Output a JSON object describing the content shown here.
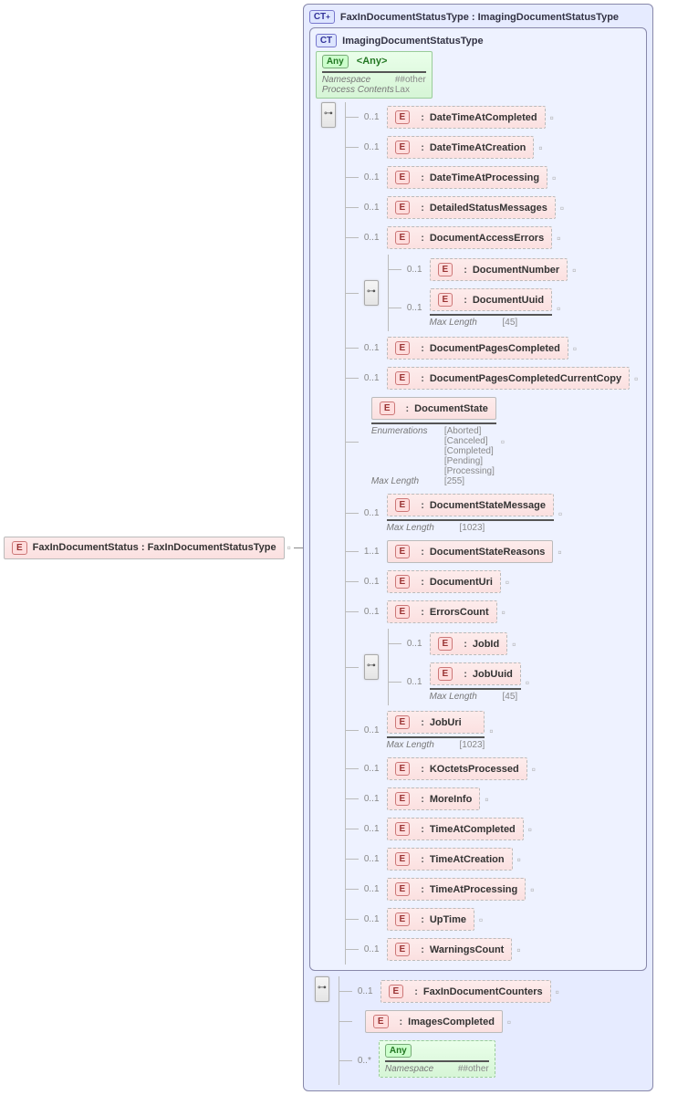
{
  "root": {
    "badge": "E",
    "label": "FaxInDocumentStatus : FaxInDocumentStatusType"
  },
  "outer_ct": {
    "badge": "CT",
    "badge_plus": true,
    "label": "FaxInDocumentStatusType : ImagingDocumentStatusType"
  },
  "inner_ct": {
    "badge": "CT",
    "label": "ImagingDocumentStatusType"
  },
  "any_top": {
    "badge": "Any",
    "label": "<Any>",
    "facets": [
      {
        "k": "Namespace",
        "v": "##other"
      },
      {
        "k": "Process Contents",
        "v": "Lax"
      }
    ]
  },
  "inner_children": [
    {
      "card": "0..1",
      "ref": "<Ref>",
      "name": "DateTimeAtCompleted"
    },
    {
      "card": "0..1",
      "ref": "<Ref>",
      "name": "DateTimeAtCreation"
    },
    {
      "card": "0..1",
      "ref": "<Ref>",
      "name": "DateTimeAtProcessing"
    },
    {
      "card": "0..1",
      "ref": "<Ref>",
      "name": "DetailedStatusMessages"
    },
    {
      "card": "0..1",
      "ref": "<Ref>",
      "name": "DocumentAccessErrors"
    },
    {
      "compositor": true,
      "children": [
        {
          "card": "0..1",
          "ref": "<Ref>",
          "name": "DocumentNumber"
        },
        {
          "card": "0..1",
          "ref": "<Ref>",
          "name": "DocumentUuid",
          "facets": [
            {
              "k": "Max Length",
              "v": "[45]"
            }
          ]
        }
      ]
    },
    {
      "card": "0..1",
      "ref": "<Ref>",
      "name": "DocumentPagesCompleted"
    },
    {
      "card": "0..1",
      "ref": "<Ref>",
      "name": "DocumentPagesCompletedCurrentCopy",
      "long": true
    },
    {
      "card": "",
      "ref": "<Ref>",
      "name": "DocumentState",
      "facets": [
        {
          "k": "Enumerations",
          "v": "[Aborted]"
        },
        {
          "k": "",
          "v": "[Canceled]"
        },
        {
          "k": "",
          "v": "[Completed]"
        },
        {
          "k": "",
          "v": "[Pending]"
        },
        {
          "k": "",
          "v": "[Processing]"
        },
        {
          "k": "Max Length",
          "v": "[255]"
        }
      ]
    },
    {
      "card": "0..1",
      "ref": "<Ref>",
      "name": "DocumentStateMessage",
      "facets": [
        {
          "k": "Max Length",
          "v": "[1023]"
        }
      ]
    },
    {
      "card": "1..1",
      "ref": "<Ref>",
      "name": "DocumentStateReasons"
    },
    {
      "card": "0..1",
      "ref": "<Ref>",
      "name": "DocumentUri"
    },
    {
      "card": "0..1",
      "ref": "<Ref>",
      "name": "ErrorsCount"
    },
    {
      "compositor": true,
      "children": [
        {
          "card": "0..1",
          "ref": "<Ref>",
          "name": "JobId"
        },
        {
          "card": "0..1",
          "ref": "<Ref>",
          "name": "JobUuid",
          "facets": [
            {
              "k": "Max Length",
              "v": "[45]"
            }
          ]
        }
      ]
    },
    {
      "card": "0..1",
      "ref": "<Ref>",
      "name": "JobUri",
      "facets": [
        {
          "k": "Max Length",
          "v": "[1023]"
        }
      ]
    },
    {
      "card": "0..1",
      "ref": "<Ref>",
      "name": "KOctetsProcessed"
    },
    {
      "card": "0..1",
      "ref": "<Ref>",
      "name": "MoreInfo"
    },
    {
      "card": "0..1",
      "ref": "<Ref>",
      "name": "TimeAtCompleted"
    },
    {
      "card": "0..1",
      "ref": "<Ref>",
      "name": "TimeAtCreation"
    },
    {
      "card": "0..1",
      "ref": "<Ref>",
      "name": "TimeAtProcessing"
    },
    {
      "card": "0..1",
      "ref": "<Ref>",
      "name": "UpTime"
    },
    {
      "card": "0..1",
      "ref": "<Ref>",
      "name": "WarningsCount"
    }
  ],
  "outer_extra": [
    {
      "card": "0..1",
      "ref": "<Ref>",
      "name": "FaxInDocumentCounters"
    },
    {
      "card": "",
      "ref": "<Ref>",
      "name": "ImagesCompleted"
    },
    {
      "any": true,
      "card": "0..*",
      "badge": "Any",
      "label": "<Any>",
      "facets": [
        {
          "k": "Namespace",
          "v": "##other"
        }
      ]
    }
  ]
}
